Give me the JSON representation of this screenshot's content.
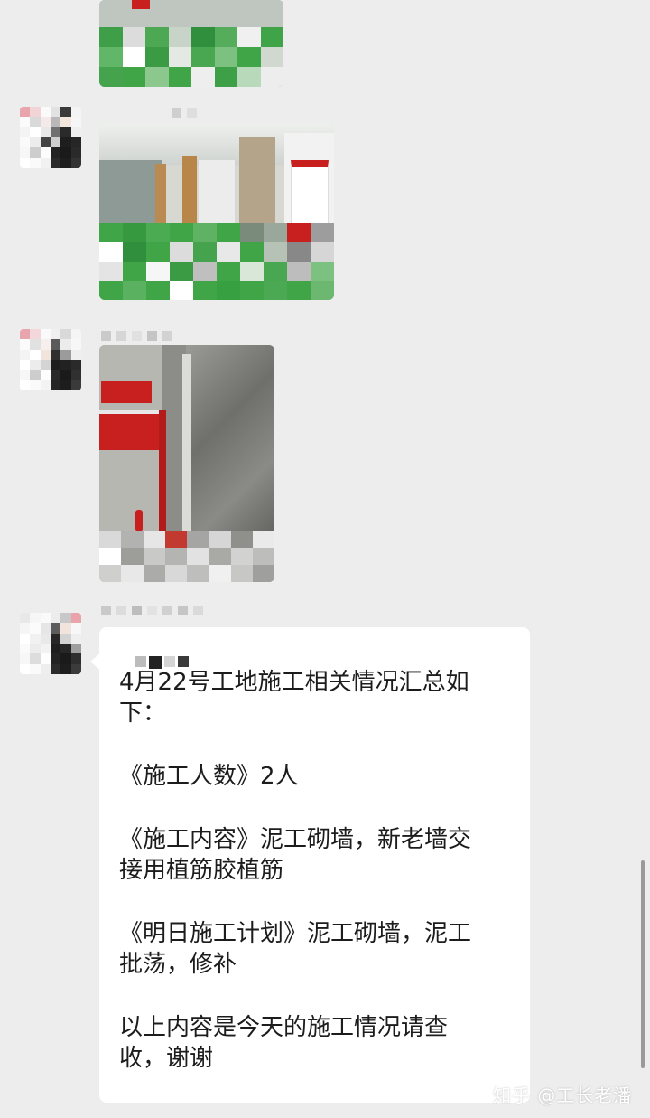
{
  "chat": {
    "message_text": {
      "line1": "4月22号工地施工相关情况汇总如",
      "line2": "下：",
      "line3": "《施工人数》2人",
      "line4": "《施工内容》泥工砌墙，新老墙交",
      "line5": "接用植筋胶植筋",
      "line6": "《明日施工计划》泥工砌墙，泥工",
      "line7": "批荡，修补",
      "line8": "以上内容是今天的施工情况请查",
      "line9": "收，谢谢"
    }
  },
  "watermark": {
    "text": "知乎 @工长老潘"
  },
  "colors": {
    "background": "#ededed",
    "bubble": "#ffffff",
    "text": "#1c1c1c",
    "mosaic_green": "#3fa547",
    "construction_red": "#c8201e"
  }
}
